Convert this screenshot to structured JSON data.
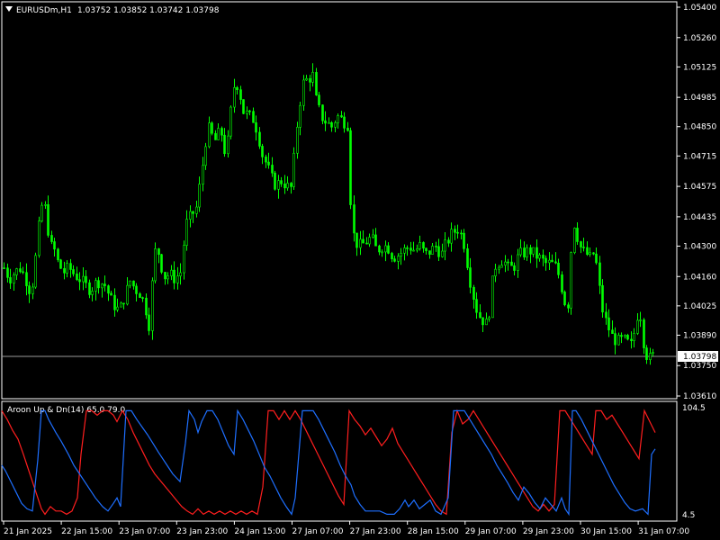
{
  "header": {
    "symbol": "EURUSDm,H1",
    "ohlc": "1.03752 1.03852 1.03742 1.03798"
  },
  "price_axis": {
    "ticks": [
      "1.05400",
      "1.05260",
      "1.05125",
      "1.04985",
      "1.04850",
      "1.04715",
      "1.04575",
      "1.04435",
      "1.04300",
      "1.04160",
      "1.04025",
      "1.03890",
      "1.03750",
      "1.03610"
    ],
    "current_price": "1.03798"
  },
  "indicator": {
    "label": "Aroon Up & Dn(14) 65.0 79.0",
    "scale_max": "104.5",
    "scale_min": "4.5",
    "up_value": 65.0,
    "down_value": 79.0
  },
  "time_axis": {
    "labels": [
      "21 Jan 2025",
      "22 Jan 15:00",
      "23 Jan 07:00",
      "23 Jan 23:00",
      "24 Jan 15:00",
      "27 Jan 07:00",
      "27 Jan 23:00",
      "28 Jan 15:00",
      "29 Jan 07:00",
      "29 Jan 23:00",
      "30 Jan 15:00",
      "31 Jan 07:00"
    ]
  },
  "colors": {
    "background": "#000000",
    "candle": "#00ff00",
    "aroon_up": "#1e6fff",
    "aroon_down": "#ff1e1e",
    "grid_text": "#ffffff"
  },
  "chart_data": {
    "type": "line",
    "title": "EURUSDm,H1",
    "main_series": {
      "name": "EURUSDm",
      "x": [
        "21 Jan 2025",
        "22 Jan 15:00",
        "23 Jan 07:00",
        "23 Jan 23:00",
        "24 Jan 15:00",
        "27 Jan 07:00",
        "27 Jan 23:00",
        "28 Jan 15:00",
        "29 Jan 07:00",
        "29 Jan 23:00",
        "30 Jan 15:00",
        "31 Jan 07:00"
      ],
      "y": [
        1.0418,
        1.0426,
        1.0412,
        1.0478,
        1.047,
        1.0512,
        1.0436,
        1.0428,
        1.0395,
        1.0426,
        1.043,
        1.038
      ]
    },
    "path": [
      [
        0,
        1.0428
      ],
      [
        4,
        1.042
      ],
      [
        10,
        1.0415
      ],
      [
        16,
        1.0418
      ],
      [
        22,
        1.042
      ],
      [
        28,
        1.0415
      ],
      [
        34,
        1.0408
      ],
      [
        40,
        1.0428
      ],
      [
        44,
        1.0445
      ],
      [
        48,
        1.0452
      ],
      [
        52,
        1.044
      ],
      [
        56,
        1.043
      ],
      [
        60,
        1.0428
      ],
      [
        64,
        1.0422
      ],
      [
        70,
        1.0418
      ],
      [
        76,
        1.042
      ],
      [
        82,
        1.0417
      ],
      [
        88,
        1.0415
      ],
      [
        94,
        1.0412
      ],
      [
        100,
        1.041
      ],
      [
        108,
        1.0414
      ],
      [
        116,
        1.0412
      ],
      [
        124,
        1.0404
      ],
      [
        132,
        1.04
      ],
      [
        138,
        1.0407
      ],
      [
        144,
        1.0414
      ],
      [
        150,
        1.041
      ],
      [
        156,
        1.0408
      ],
      [
        162,
        1.04
      ],
      [
        166,
        1.0392
      ],
      [
        170,
        1.0425
      ],
      [
        174,
        1.043
      ],
      [
        178,
        1.0422
      ],
      [
        182,
        1.0416
      ],
      [
        188,
        1.0417
      ],
      [
        194,
        1.0415
      ],
      [
        200,
        1.0418
      ],
      [
        206,
        1.044
      ],
      [
        212,
        1.0444
      ],
      [
        218,
        1.0448
      ],
      [
        222,
        1.046
      ],
      [
        226,
        1.0472
      ],
      [
        230,
        1.0485
      ],
      [
        236,
        1.048
      ],
      [
        240,
        1.0478
      ],
      [
        244,
        1.0485
      ],
      [
        250,
        1.0472
      ],
      [
        254,
        1.0482
      ],
      [
        258,
        1.0502
      ],
      [
        262,
        1.0506
      ],
      [
        266,
        1.05
      ],
      [
        270,
        1.0492
      ],
      [
        276,
        1.049
      ],
      [
        282,
        1.0488
      ],
      [
        288,
        1.0478
      ],
      [
        292,
        1.047
      ],
      [
        296,
        1.0468
      ],
      [
        300,
        1.0462
      ],
      [
        306,
        1.0458
      ],
      [
        312,
        1.046
      ],
      [
        318,
        1.0458
      ],
      [
        322,
        1.0455
      ],
      [
        326,
        1.047
      ],
      [
        330,
        1.0488
      ],
      [
        334,
        1.05
      ],
      [
        338,
        1.0508
      ],
      [
        342,
        1.0505
      ],
      [
        346,
        1.0512
      ],
      [
        350,
        1.0498
      ],
      [
        356,
        1.049
      ],
      [
        362,
        1.0487
      ],
      [
        368,
        1.0485
      ],
      [
        374,
        1.049
      ],
      [
        380,
        1.0488
      ],
      [
        386,
        1.0486
      ],
      [
        390,
        1.044
      ],
      [
        394,
        1.0432
      ],
      [
        400,
        1.043
      ],
      [
        406,
        1.0432
      ],
      [
        412,
        1.0434
      ],
      [
        418,
        1.0428
      ],
      [
        424,
        1.043
      ],
      [
        430,
        1.043
      ],
      [
        436,
        1.0425
      ],
      [
        442,
        1.0426
      ],
      [
        448,
        1.0428
      ],
      [
        454,
        1.043
      ],
      [
        460,
        1.0428
      ],
      [
        466,
        1.043
      ],
      [
        472,
        1.0426
      ],
      [
        478,
        1.0428
      ],
      [
        484,
        1.043
      ],
      [
        490,
        1.0426
      ],
      [
        496,
        1.0432
      ],
      [
        502,
        1.0436
      ],
      [
        508,
        1.0438
      ],
      [
        512,
        1.0435
      ],
      [
        516,
        1.043
      ],
      [
        520,
        1.0418
      ],
      [
        524,
        1.041
      ],
      [
        528,
        1.0402
      ],
      [
        532,
        1.0398
      ],
      [
        536,
        1.0396
      ],
      [
        540,
        1.0394
      ],
      [
        544,
        1.0402
      ],
      [
        548,
        1.042
      ],
      [
        552,
        1.0422
      ],
      [
        558,
        1.0424
      ],
      [
        564,
        1.042
      ],
      [
        570,
        1.042
      ],
      [
        576,
        1.0426
      ],
      [
        582,
        1.0427
      ],
      [
        588,
        1.0428
      ],
      [
        594,
        1.0426
      ],
      [
        600,
        1.0424
      ],
      [
        606,
        1.0422
      ],
      [
        612,
        1.0422
      ],
      [
        618,
        1.042
      ],
      [
        622,
        1.0414
      ],
      [
        626,
        1.0406
      ],
      [
        630,
        1.04
      ],
      [
        634,
        1.0428
      ],
      [
        638,
        1.0442
      ],
      [
        642,
        1.0432
      ],
      [
        646,
        1.0428
      ],
      [
        652,
        1.0426
      ],
      [
        656,
        1.0424
      ],
      [
        660,
        1.0428
      ],
      [
        664,
        1.0415
      ],
      [
        668,
        1.0402
      ],
      [
        672,
        1.0396
      ],
      [
        676,
        1.0392
      ],
      [
        680,
        1.0388
      ],
      [
        686,
        1.0386
      ],
      [
        692,
        1.0387
      ],
      [
        698,
        1.0385
      ],
      [
        702,
        1.0384
      ],
      [
        706,
        1.0396
      ],
      [
        710,
        1.0402
      ],
      [
        714,
        1.0387
      ],
      [
        718,
        1.038
      ],
      [
        722,
        1.0378
      ],
      [
        726,
        1.038
      ],
      [
        730,
        1.038
      ]
    ],
    "aroon_up_path": [
      [
        0,
        50
      ],
      [
        4,
        45
      ],
      [
        10,
        35
      ],
      [
        16,
        25
      ],
      [
        22,
        15
      ],
      [
        28,
        10
      ],
      [
        34,
        8
      ],
      [
        40,
        55
      ],
      [
        44,
        100
      ],
      [
        48,
        100
      ],
      [
        52,
        92
      ],
      [
        60,
        80
      ],
      [
        66,
        72
      ],
      [
        74,
        60
      ],
      [
        80,
        50
      ],
      [
        88,
        40
      ],
      [
        96,
        30
      ],
      [
        104,
        20
      ],
      [
        112,
        12
      ],
      [
        118,
        8
      ],
      [
        124,
        15
      ],
      [
        128,
        20
      ],
      [
        132,
        12
      ],
      [
        138,
        100
      ],
      [
        144,
        100
      ],
      [
        150,
        92
      ],
      [
        156,
        85
      ],
      [
        162,
        78
      ],
      [
        168,
        70
      ],
      [
        174,
        62
      ],
      [
        182,
        52
      ],
      [
        190,
        42
      ],
      [
        198,
        35
      ],
      [
        204,
        70
      ],
      [
        208,
        100
      ],
      [
        214,
        92
      ],
      [
        218,
        80
      ],
      [
        222,
        90
      ],
      [
        228,
        100
      ],
      [
        234,
        100
      ],
      [
        240,
        92
      ],
      [
        246,
        80
      ],
      [
        252,
        68
      ],
      [
        258,
        60
      ],
      [
        262,
        100
      ],
      [
        268,
        92
      ],
      [
        274,
        82
      ],
      [
        280,
        72
      ],
      [
        286,
        60
      ],
      [
        292,
        48
      ],
      [
        298,
        40
      ],
      [
        304,
        30
      ],
      [
        310,
        20
      ],
      [
        316,
        12
      ],
      [
        322,
        5
      ],
      [
        326,
        20
      ],
      [
        330,
        60
      ],
      [
        334,
        100
      ],
      [
        340,
        100
      ],
      [
        346,
        100
      ],
      [
        352,
        92
      ],
      [
        358,
        82
      ],
      [
        364,
        72
      ],
      [
        370,
        62
      ],
      [
        376,
        50
      ],
      [
        382,
        40
      ],
      [
        388,
        32
      ],
      [
        392,
        22
      ],
      [
        398,
        14
      ],
      [
        404,
        8
      ],
      [
        412,
        8
      ],
      [
        420,
        8
      ],
      [
        428,
        5
      ],
      [
        436,
        5
      ],
      [
        442,
        10
      ],
      [
        448,
        18
      ],
      [
        452,
        12
      ],
      [
        458,
        18
      ],
      [
        464,
        10
      ],
      [
        470,
        14
      ],
      [
        476,
        18
      ],
      [
        482,
        8
      ],
      [
        488,
        5
      ],
      [
        496,
        20
      ],
      [
        502,
        100
      ],
      [
        508,
        100
      ],
      [
        514,
        100
      ],
      [
        520,
        92
      ],
      [
        526,
        84
      ],
      [
        532,
        76
      ],
      [
        538,
        68
      ],
      [
        544,
        60
      ],
      [
        550,
        50
      ],
      [
        556,
        42
      ],
      [
        562,
        34
      ],
      [
        568,
        25
      ],
      [
        574,
        18
      ],
      [
        580,
        30
      ],
      [
        586,
        24
      ],
      [
        592,
        16
      ],
      [
        598,
        10
      ],
      [
        604,
        20
      ],
      [
        610,
        14
      ],
      [
        616,
        8
      ],
      [
        622,
        20
      ],
      [
        626,
        10
      ],
      [
        630,
        5
      ],
      [
        634,
        100
      ],
      [
        638,
        100
      ],
      [
        644,
        92
      ],
      [
        650,
        82
      ],
      [
        656,
        72
      ],
      [
        662,
        62
      ],
      [
        668,
        52
      ],
      [
        674,
        42
      ],
      [
        680,
        32
      ],
      [
        686,
        24
      ],
      [
        692,
        16
      ],
      [
        698,
        10
      ],
      [
        704,
        8
      ],
      [
        712,
        10
      ],
      [
        718,
        5
      ],
      [
        722,
        60
      ],
      [
        726,
        65
      ]
    ],
    "aroon_down_path": [
      [
        0,
        100
      ],
      [
        6,
        92
      ],
      [
        12,
        82
      ],
      [
        18,
        74
      ],
      [
        24,
        60
      ],
      [
        30,
        45
      ],
      [
        36,
        30
      ],
      [
        40,
        20
      ],
      [
        44,
        10
      ],
      [
        48,
        5
      ],
      [
        54,
        12
      ],
      [
        60,
        8
      ],
      [
        66,
        8
      ],
      [
        72,
        5
      ],
      [
        78,
        8
      ],
      [
        84,
        20
      ],
      [
        88,
        60
      ],
      [
        94,
        100
      ],
      [
        100,
        100
      ],
      [
        106,
        96
      ],
      [
        112,
        100
      ],
      [
        118,
        100
      ],
      [
        124,
        96
      ],
      [
        128,
        90
      ],
      [
        134,
        100
      ],
      [
        140,
        92
      ],
      [
        146,
        80
      ],
      [
        152,
        70
      ],
      [
        158,
        60
      ],
      [
        164,
        50
      ],
      [
        170,
        42
      ],
      [
        176,
        36
      ],
      [
        182,
        30
      ],
      [
        188,
        24
      ],
      [
        194,
        18
      ],
      [
        200,
        12
      ],
      [
        206,
        8
      ],
      [
        212,
        5
      ],
      [
        218,
        10
      ],
      [
        224,
        5
      ],
      [
        230,
        8
      ],
      [
        236,
        5
      ],
      [
        242,
        8
      ],
      [
        248,
        5
      ],
      [
        254,
        8
      ],
      [
        260,
        5
      ],
      [
        266,
        8
      ],
      [
        272,
        5
      ],
      [
        278,
        8
      ],
      [
        284,
        5
      ],
      [
        290,
        30
      ],
      [
        296,
        100
      ],
      [
        302,
        100
      ],
      [
        308,
        92
      ],
      [
        314,
        100
      ],
      [
        320,
        92
      ],
      [
        326,
        100
      ],
      [
        332,
        92
      ],
      [
        338,
        82
      ],
      [
        344,
        72
      ],
      [
        350,
        62
      ],
      [
        356,
        52
      ],
      [
        362,
        42
      ],
      [
        368,
        32
      ],
      [
        374,
        22
      ],
      [
        380,
        14
      ],
      [
        386,
        100
      ],
      [
        392,
        92
      ],
      [
        398,
        86
      ],
      [
        404,
        78
      ],
      [
        410,
        84
      ],
      [
        416,
        76
      ],
      [
        422,
        68
      ],
      [
        428,
        74
      ],
      [
        434,
        84
      ],
      [
        440,
        70
      ],
      [
        446,
        62
      ],
      [
        452,
        54
      ],
      [
        458,
        46
      ],
      [
        464,
        38
      ],
      [
        470,
        30
      ],
      [
        476,
        22
      ],
      [
        482,
        14
      ],
      [
        488,
        8
      ],
      [
        494,
        5
      ],
      [
        500,
        80
      ],
      [
        506,
        100
      ],
      [
        512,
        88
      ],
      [
        518,
        92
      ],
      [
        524,
        100
      ],
      [
        530,
        92
      ],
      [
        536,
        84
      ],
      [
        542,
        76
      ],
      [
        548,
        68
      ],
      [
        554,
        60
      ],
      [
        560,
        52
      ],
      [
        566,
        44
      ],
      [
        572,
        36
      ],
      [
        578,
        28
      ],
      [
        584,
        20
      ],
      [
        590,
        12
      ],
      [
        596,
        8
      ],
      [
        602,
        14
      ],
      [
        608,
        8
      ],
      [
        614,
        14
      ],
      [
        620,
        100
      ],
      [
        626,
        100
      ],
      [
        632,
        92
      ],
      [
        638,
        84
      ],
      [
        644,
        76
      ],
      [
        650,
        68
      ],
      [
        656,
        60
      ],
      [
        660,
        100
      ],
      [
        666,
        100
      ],
      [
        672,
        92
      ],
      [
        678,
        96
      ],
      [
        684,
        88
      ],
      [
        690,
        80
      ],
      [
        696,
        72
      ],
      [
        702,
        64
      ],
      [
        708,
        56
      ],
      [
        714,
        100
      ],
      [
        720,
        90
      ],
      [
        726,
        80
      ]
    ],
    "ylim": [
      1.0361,
      1.054
    ],
    "aroon_ylim": [
      4.5,
      104.5
    ],
    "grid": false,
    "legend": "none"
  }
}
